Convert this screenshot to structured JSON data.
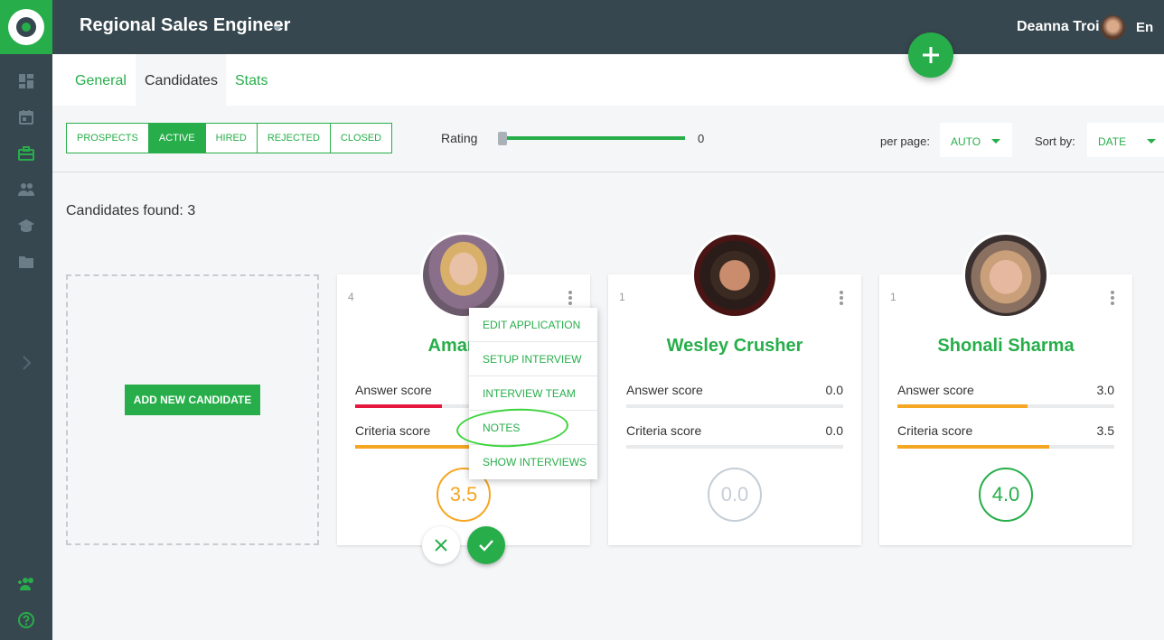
{
  "header": {
    "title": "Regional Sales Engineer",
    "user_name": "Deanna Troi",
    "language": "En"
  },
  "tabs": [
    {
      "label": "General",
      "active": false
    },
    {
      "label": "Candidates",
      "active": true
    },
    {
      "label": "Stats",
      "active": false
    }
  ],
  "filters": {
    "status_buttons": [
      "PROSPECTS",
      "ACTIVE",
      "HIRED",
      "REJECTED",
      "CLOSED"
    ],
    "active_status": "ACTIVE",
    "rating_label": "Rating",
    "rating_value": "0",
    "per_page_label": "per page:",
    "per_page_value": "AUTO",
    "sort_label": "Sort by:",
    "sort_value": "DATE"
  },
  "candidates_found": "Candidates found: 3",
  "add_candidate_label": "ADD NEW CANDIDATE",
  "score_labels": {
    "answer": "Answer score",
    "criteria": "Criteria score"
  },
  "candidates": [
    {
      "num": "4",
      "name": "Amanda",
      "answer_score": "",
      "answer_fill": 0.4,
      "answer_color": "#e5173f",
      "criteria_score": "",
      "criteria_fill": 0.7,
      "criteria_color": "#f5a623",
      "overall": "3.5",
      "overall_color": "#f5a623"
    },
    {
      "num": "1",
      "name": "Wesley Crusher",
      "answer_score": "0.0",
      "answer_fill": 0,
      "criteria_score": "0.0",
      "criteria_fill": 0,
      "overall": "0.0",
      "overall_color": "#c5ced6"
    },
    {
      "num": "1",
      "name": "Shonali Sharma",
      "answer_score": "3.0",
      "answer_fill": 0.6,
      "answer_color": "#f5a623",
      "criteria_score": "3.5",
      "criteria_fill": 0.7,
      "criteria_color": "#f5a623",
      "overall": "4.0",
      "overall_color": "#27ae4a"
    }
  ],
  "menu_items": [
    "EDIT APPLICATION",
    "SETUP INTERVIEW",
    "INTERVIEW TEAM",
    "NOTES",
    "SHOW INTERVIEWS"
  ],
  "colors": {
    "brand": "#27ae4a",
    "sidebar": "#37474f",
    "highlight": "#3bd43b"
  }
}
